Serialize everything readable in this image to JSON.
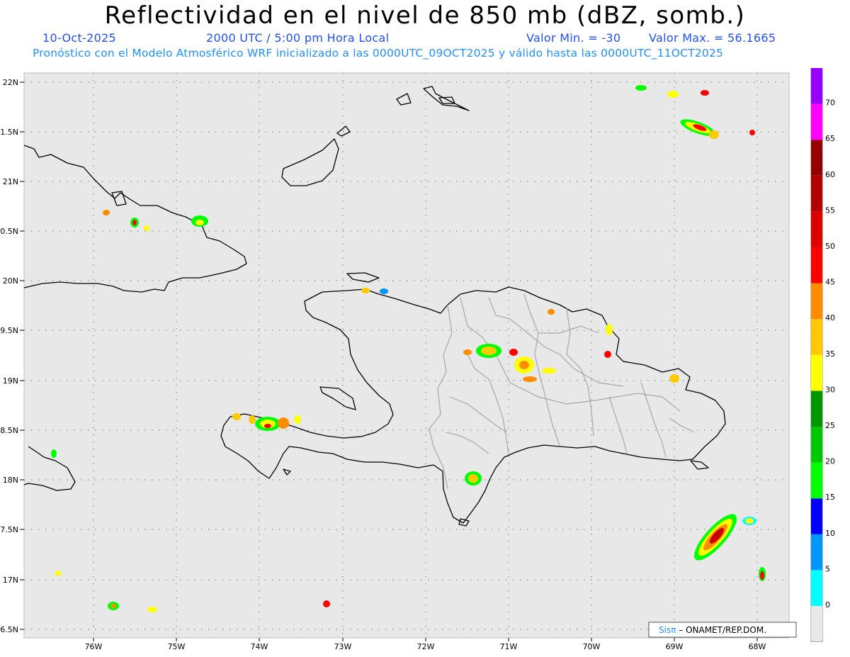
{
  "header": {
    "title": "Reflectividad en el nivel de 850 mb (dBZ, somb.)",
    "date": "10-Oct-2025",
    "time": "2000 UTC / 5:00 pm Hora Local",
    "value_min": "Valor Min. = -30",
    "value_max": "Valor Max. = 56.1665",
    "model_info": "Pronóstico con el Modelo Atmosférico WRF inicializado a las 0000UTC_09OCT2025 y válido hasta las  0000UTC_11OCT2025"
  },
  "map": {
    "lat_labels": [
      "22N",
      "21.5N",
      "21N",
      "20.5N",
      "20N",
      "19.5N",
      "19N",
      "18.5N",
      "18N",
      "17.5N",
      "17N",
      "16.5N"
    ],
    "lon_labels": [
      "76W",
      "75W",
      "74W",
      "73W",
      "72W",
      "71W",
      "70W",
      "69W",
      "68W"
    ],
    "credit_logo": "Sisπ",
    "credit_text": " – ONAMET/REP.DOM."
  },
  "colorbar": {
    "labels": [
      "0",
      "5",
      "10",
      "15",
      "20",
      "25",
      "30",
      "35",
      "40",
      "45",
      "50",
      "55",
      "60",
      "65",
      "70"
    ],
    "colors": [
      "#00ffff",
      "#0096ff",
      "#0000ff",
      "#00ff00",
      "#00c800",
      "#009600",
      "#ffff00",
      "#ffc800",
      "#ff8c00",
      "#ff0000",
      "#dc0000",
      "#b40000",
      "#960000",
      "#ff00ff",
      "#9600ff"
    ]
  }
}
